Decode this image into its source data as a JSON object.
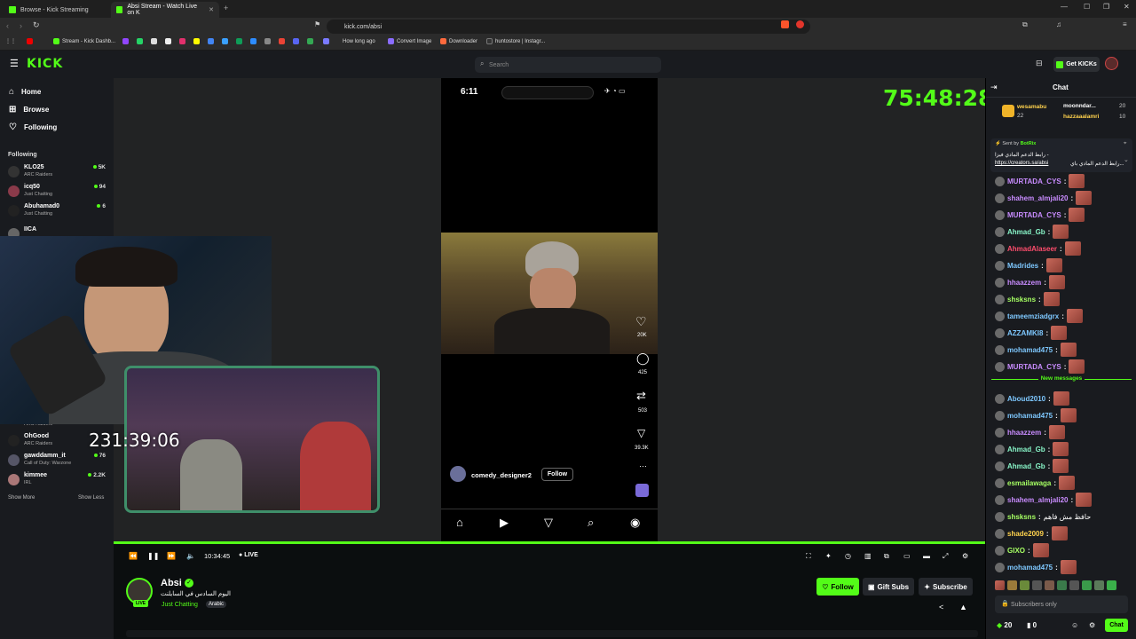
{
  "browser": {
    "tabs": [
      {
        "title": "Browse - Kick Streaming"
      },
      {
        "title": "Absi Stream - Watch Live on K"
      }
    ],
    "url": "kick.com/absi",
    "bookmarks": [
      "Stream - Kick Dashb...",
      "How long ago",
      "Convert Image",
      "Downloader",
      "huntostore | Instagr..."
    ]
  },
  "header": {
    "logo": "KICK",
    "search_placeholder": "Search",
    "get_kicks": "Get KICKs"
  },
  "sidebar": {
    "nav": [
      {
        "label": "Home",
        "icon": "home-icon"
      },
      {
        "label": "Browse",
        "icon": "compass-icon"
      },
      {
        "label": "Following",
        "icon": "heart-icon"
      }
    ],
    "following_heading": "Following",
    "following": [
      {
        "name": "KLO25",
        "category": "ARC Raiders",
        "viewers": "5K"
      },
      {
        "name": "icq50",
        "category": "Just Chatting",
        "viewers": "94"
      },
      {
        "name": "Abuhamad0",
        "category": "Just Chatting",
        "viewers": "6"
      },
      {
        "name": "IICA",
        "category": "",
        "viewers": ""
      },
      {
        "name": "",
        "category": "ARC Raiders",
        "viewers": ""
      },
      {
        "name": "OhGood",
        "category": "ARC Raiders",
        "viewers": ""
      },
      {
        "name": "gawddamm_it",
        "category": "Call of Duty: Warzone",
        "viewers": "76"
      },
      {
        "name": "kimmee",
        "category": "IRL",
        "viewers": "2.2K"
      }
    ],
    "show_more": "Show More",
    "show_less": "Show Less"
  },
  "stream": {
    "overlay_timer_right": "75:48:28",
    "overlay_timer_left": "231:39:06",
    "phone": {
      "clock": "6:11",
      "likes": "20K",
      "comments": "425",
      "reposts": "503",
      "shares": "39.3K",
      "username": "comedy_designer2",
      "follow": "Follow"
    }
  },
  "player": {
    "time": "10:34:45",
    "live": "LIVE"
  },
  "channel": {
    "name": "Absi",
    "title": "اليوم السادس في السايلنت",
    "category": "Just Chatting",
    "tag": "Arabic",
    "live_badge": "LIVE",
    "follow": "Follow",
    "gift_subs": "Gift Subs",
    "subscribe": "Subscribe"
  },
  "chat": {
    "title": "Chat",
    "gifters": [
      {
        "name": "wesamabu",
        "count": "22"
      },
      {
        "name": "moonndar...",
        "count": "20"
      },
      {
        "name": "hazzaaalamri",
        "count": "10"
      }
    ],
    "pinned": {
      "sent_by": "Sent by",
      "bot": "BotRix",
      "text": "رابط الدعم المادي فيزا -",
      "link": "https://creators.sa/absi",
      "link_suffix": "رابط الدعم المادي باي..."
    },
    "messages": [
      {
        "user": "MURTADA_CYS",
        "color": "#c98cff",
        "text": ""
      },
      {
        "user": "shahem_almjali20",
        "color": "#c98cff",
        "text": ""
      },
      {
        "user": "MURTADA_CYS",
        "color": "#c98cff",
        "text": ""
      },
      {
        "user": "Ahmad_Gb",
        "color": "#88f5c8",
        "text": ""
      },
      {
        "user": "AhmadAlaseer",
        "color": "#ff4d6d",
        "text": ""
      },
      {
        "user": "Madrides",
        "color": "#7ec8ff",
        "text": ""
      },
      {
        "user": "hhaazzem",
        "color": "#c98cff",
        "text": ""
      },
      {
        "user": "shsksns",
        "color": "#a6ff63",
        "text": ""
      },
      {
        "user": "tameemziadgrx",
        "color": "#7ec8ff",
        "text": ""
      },
      {
        "user": "AZZAMKI8",
        "color": "#7ec8ff",
        "text": ""
      },
      {
        "user": "mohamad475",
        "color": "#7ec8ff",
        "text": ""
      },
      {
        "user": "MURTADA_CYS",
        "color": "#c98cff",
        "text": ""
      }
    ],
    "new_messages": "New messages",
    "messages2": [
      {
        "user": "Aboud2010",
        "color": "#7ec8ff",
        "text": ""
      },
      {
        "user": "mohamad475",
        "color": "#7ec8ff",
        "text": ""
      },
      {
        "user": "hhaazzem",
        "color": "#c98cff",
        "text": ""
      },
      {
        "user": "Ahmad_Gb",
        "color": "#88f5c8",
        "text": ""
      },
      {
        "user": "Ahmad_Gb",
        "color": "#88f5c8",
        "text": ""
      },
      {
        "user": "esmailawaga",
        "color": "#a6ff63",
        "text": ""
      },
      {
        "user": "shahem_almjali20",
        "color": "#c98cff",
        "text": ""
      },
      {
        "user": "shsksns",
        "color": "#a6ff63",
        "text": "حافظ مش فاهم"
      },
      {
        "user": "shade2009",
        "color": "#ffd24d",
        "text": ""
      },
      {
        "user": "GIXO",
        "color": "#a6ff63",
        "text": ""
      },
      {
        "user": "mohamad475",
        "color": "#7ec8ff",
        "text": ""
      }
    ],
    "input_placeholder": "Subscribers only",
    "kicks_count": "20",
    "zero_count": "0",
    "send": "Chat"
  },
  "colors": {
    "accent": "#53fc18",
    "bg": "#0b0e0f",
    "panel": "#191b1f"
  }
}
